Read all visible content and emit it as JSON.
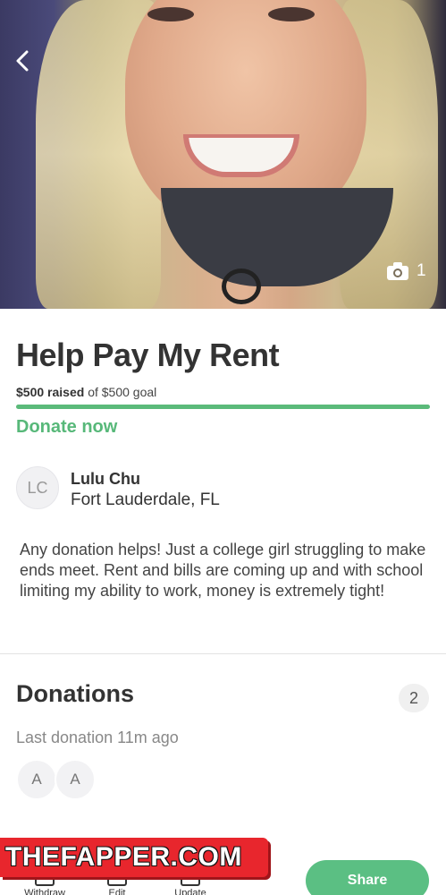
{
  "campaign": {
    "title": "Help Pay My Rent",
    "raised_amount": "$500 raised",
    "goal_text": "of $500 goal",
    "progress": 1.0,
    "donate_label": "Donate now",
    "story": "Any donation helps! Just a college girl struggling to make ends meet. Rent and bills are coming up and with school limiting my ability to work, money is extremely tight!"
  },
  "hero": {
    "photo_count": "1",
    "back_icon": "chevron-left-icon",
    "camera_icon": "camera-icon"
  },
  "organizer": {
    "initials": "LC",
    "name": "Lulu Chu",
    "location": "Fort Lauderdale, FL"
  },
  "donations": {
    "heading": "Donations",
    "count": "2",
    "last_donation": "Last donation 11m ago",
    "donors": [
      "A",
      "A"
    ]
  },
  "toolbar": {
    "withdraw": "Withdraw",
    "edit": "Edit",
    "update": "Update",
    "share": "Share"
  },
  "watermark": {
    "text": "THEFAPPER.COM"
  },
  "colors": {
    "accent_green": "#5bbf83",
    "watermark_red": "#e8262d"
  }
}
